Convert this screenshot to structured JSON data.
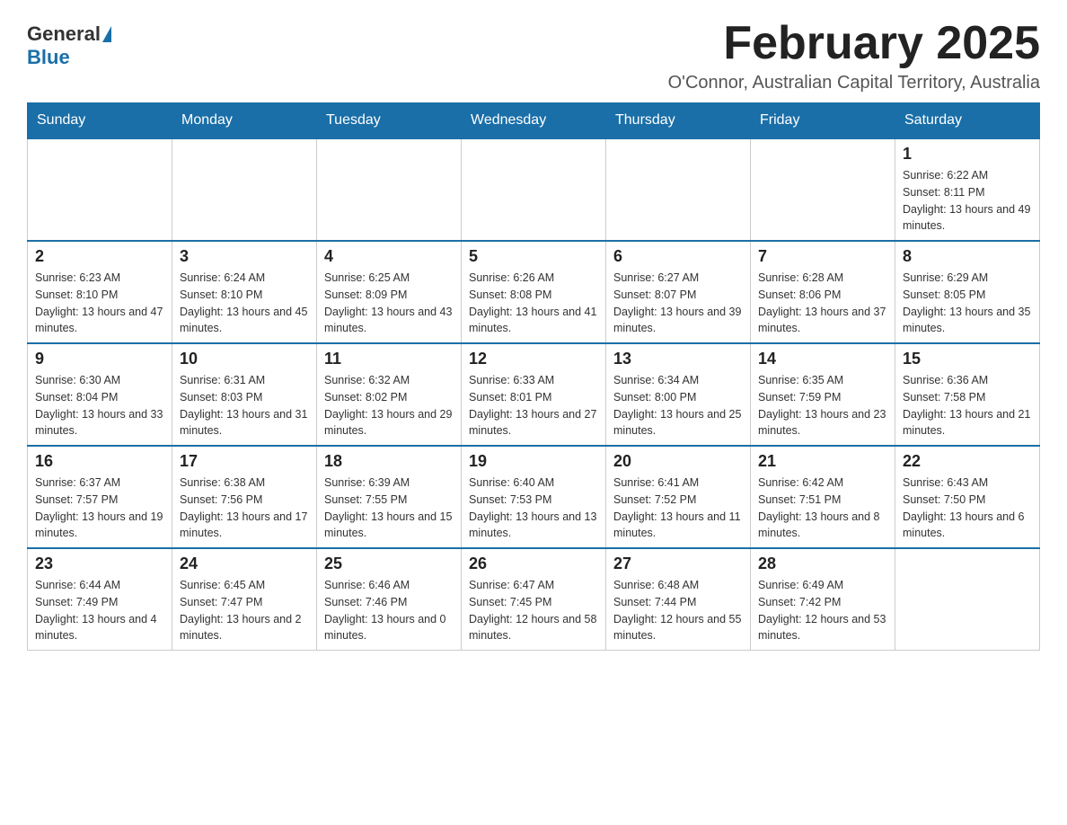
{
  "header": {
    "logo_general": "General",
    "logo_blue": "Blue",
    "main_title": "February 2025",
    "subtitle": "O'Connor, Australian Capital Territory, Australia"
  },
  "weekdays": [
    "Sunday",
    "Monday",
    "Tuesday",
    "Wednesday",
    "Thursday",
    "Friday",
    "Saturday"
  ],
  "weeks": [
    [
      {
        "day": "",
        "info": ""
      },
      {
        "day": "",
        "info": ""
      },
      {
        "day": "",
        "info": ""
      },
      {
        "day": "",
        "info": ""
      },
      {
        "day": "",
        "info": ""
      },
      {
        "day": "",
        "info": ""
      },
      {
        "day": "1",
        "info": "Sunrise: 6:22 AM\nSunset: 8:11 PM\nDaylight: 13 hours and 49 minutes."
      }
    ],
    [
      {
        "day": "2",
        "info": "Sunrise: 6:23 AM\nSunset: 8:10 PM\nDaylight: 13 hours and 47 minutes."
      },
      {
        "day": "3",
        "info": "Sunrise: 6:24 AM\nSunset: 8:10 PM\nDaylight: 13 hours and 45 minutes."
      },
      {
        "day": "4",
        "info": "Sunrise: 6:25 AM\nSunset: 8:09 PM\nDaylight: 13 hours and 43 minutes."
      },
      {
        "day": "5",
        "info": "Sunrise: 6:26 AM\nSunset: 8:08 PM\nDaylight: 13 hours and 41 minutes."
      },
      {
        "day": "6",
        "info": "Sunrise: 6:27 AM\nSunset: 8:07 PM\nDaylight: 13 hours and 39 minutes."
      },
      {
        "day": "7",
        "info": "Sunrise: 6:28 AM\nSunset: 8:06 PM\nDaylight: 13 hours and 37 minutes."
      },
      {
        "day": "8",
        "info": "Sunrise: 6:29 AM\nSunset: 8:05 PM\nDaylight: 13 hours and 35 minutes."
      }
    ],
    [
      {
        "day": "9",
        "info": "Sunrise: 6:30 AM\nSunset: 8:04 PM\nDaylight: 13 hours and 33 minutes."
      },
      {
        "day": "10",
        "info": "Sunrise: 6:31 AM\nSunset: 8:03 PM\nDaylight: 13 hours and 31 minutes."
      },
      {
        "day": "11",
        "info": "Sunrise: 6:32 AM\nSunset: 8:02 PM\nDaylight: 13 hours and 29 minutes."
      },
      {
        "day": "12",
        "info": "Sunrise: 6:33 AM\nSunset: 8:01 PM\nDaylight: 13 hours and 27 minutes."
      },
      {
        "day": "13",
        "info": "Sunrise: 6:34 AM\nSunset: 8:00 PM\nDaylight: 13 hours and 25 minutes."
      },
      {
        "day": "14",
        "info": "Sunrise: 6:35 AM\nSunset: 7:59 PM\nDaylight: 13 hours and 23 minutes."
      },
      {
        "day": "15",
        "info": "Sunrise: 6:36 AM\nSunset: 7:58 PM\nDaylight: 13 hours and 21 minutes."
      }
    ],
    [
      {
        "day": "16",
        "info": "Sunrise: 6:37 AM\nSunset: 7:57 PM\nDaylight: 13 hours and 19 minutes."
      },
      {
        "day": "17",
        "info": "Sunrise: 6:38 AM\nSunset: 7:56 PM\nDaylight: 13 hours and 17 minutes."
      },
      {
        "day": "18",
        "info": "Sunrise: 6:39 AM\nSunset: 7:55 PM\nDaylight: 13 hours and 15 minutes."
      },
      {
        "day": "19",
        "info": "Sunrise: 6:40 AM\nSunset: 7:53 PM\nDaylight: 13 hours and 13 minutes."
      },
      {
        "day": "20",
        "info": "Sunrise: 6:41 AM\nSunset: 7:52 PM\nDaylight: 13 hours and 11 minutes."
      },
      {
        "day": "21",
        "info": "Sunrise: 6:42 AM\nSunset: 7:51 PM\nDaylight: 13 hours and 8 minutes."
      },
      {
        "day": "22",
        "info": "Sunrise: 6:43 AM\nSunset: 7:50 PM\nDaylight: 13 hours and 6 minutes."
      }
    ],
    [
      {
        "day": "23",
        "info": "Sunrise: 6:44 AM\nSunset: 7:49 PM\nDaylight: 13 hours and 4 minutes."
      },
      {
        "day": "24",
        "info": "Sunrise: 6:45 AM\nSunset: 7:47 PM\nDaylight: 13 hours and 2 minutes."
      },
      {
        "day": "25",
        "info": "Sunrise: 6:46 AM\nSunset: 7:46 PM\nDaylight: 13 hours and 0 minutes."
      },
      {
        "day": "26",
        "info": "Sunrise: 6:47 AM\nSunset: 7:45 PM\nDaylight: 12 hours and 58 minutes."
      },
      {
        "day": "27",
        "info": "Sunrise: 6:48 AM\nSunset: 7:44 PM\nDaylight: 12 hours and 55 minutes."
      },
      {
        "day": "28",
        "info": "Sunrise: 6:49 AM\nSunset: 7:42 PM\nDaylight: 12 hours and 53 minutes."
      },
      {
        "day": "",
        "info": ""
      }
    ]
  ]
}
